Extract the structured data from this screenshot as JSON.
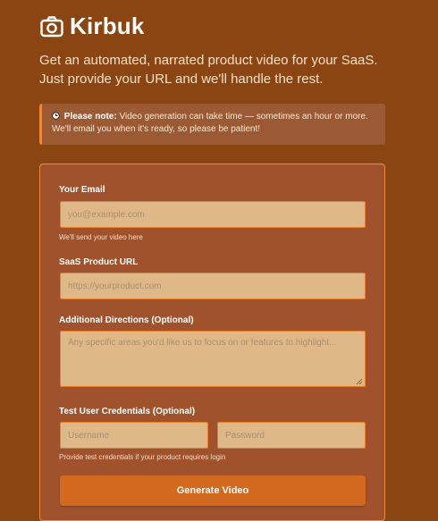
{
  "brand": {
    "name": "Kirbuk",
    "icon": "camera-icon"
  },
  "tagline": "Get an automated, narrated product video for your SaaS. Just provide your URL and we'll handle the rest.",
  "notice": {
    "icon": "clock-icon",
    "title": "Please note:",
    "text": " Video generation can take time — sometimes an hour or more. We'll email you when it's ready, so please be patient!"
  },
  "form": {
    "email": {
      "label": "Your Email",
      "placeholder": "you@example.com",
      "help": "We'll send your video here"
    },
    "url": {
      "label": "SaaS Product URL",
      "placeholder": "https://yourproduct.com"
    },
    "directions": {
      "label": "Additional Directions (Optional)",
      "placeholder": "Any specific areas you'd like us to focus on or features to highlight..."
    },
    "credentials": {
      "label": "Test User Credentials (Optional)",
      "username_placeholder": "Username",
      "password_placeholder": "Password",
      "help": "Provide test credentials if your product requires login"
    },
    "submit_label": "Generate Video"
  },
  "colors": {
    "background": "#8b4513",
    "card": "#a0522d",
    "accent": "#d2691e",
    "input": "#deb887",
    "input_border": "#e97b2c"
  }
}
